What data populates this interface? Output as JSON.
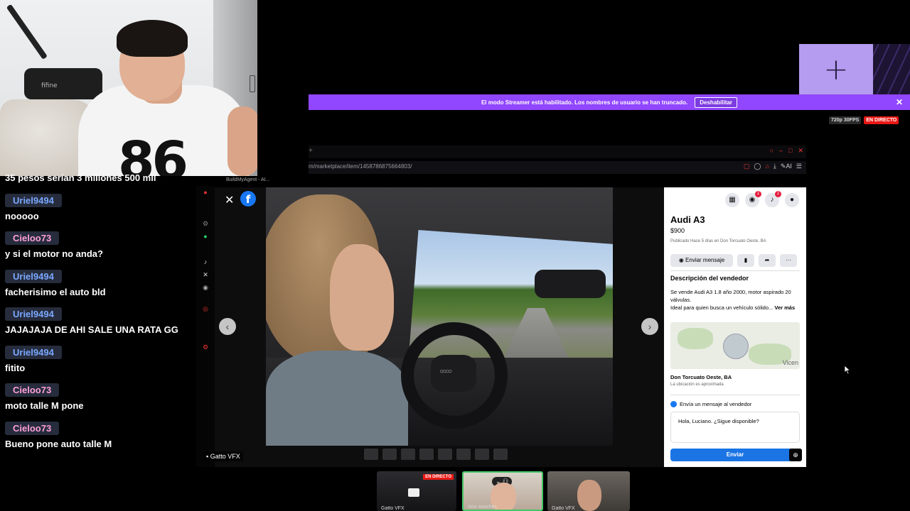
{
  "banner": {
    "text": "El modo Streamer está habilitado. Los nombres de usuario se han truncado.",
    "button": "Deshabilitar",
    "close": "✕"
  },
  "stream": {
    "quality": "720p 30FPS",
    "live": "EN DIRECTO"
  },
  "webcam": {
    "mic_brand": "fifine",
    "jersey_number": "86"
  },
  "add_tile": {
    "icon": "plus-icon"
  },
  "browser": {
    "url": "m/marketplace/item/1458786875664803/",
    "tab_label": "BuildMyAgent - AI..."
  },
  "chat": {
    "first_line": "35 pesos serían 3 millones 500 mil",
    "messages": [
      {
        "user": "Uriel9494",
        "text": "nooooo",
        "color": "blue"
      },
      {
        "user": "Cieloo73",
        "text": "y si el motor no anda?",
        "color": "pink"
      },
      {
        "user": "Uriel9494",
        "text": "facherisimo el auto bld",
        "color": "blue"
      },
      {
        "user": "Uriel9494",
        "text": "JAJAJAJA DE AHI SALE UNA RATA GG",
        "color": "blue"
      },
      {
        "user": "Uriel9494",
        "text": "fitito",
        "color": "blue"
      },
      {
        "user": "Cieloo73",
        "text": "moto talle M pone",
        "color": "pink"
      },
      {
        "user": "Cieloo73",
        "text": "Bueno pone auto talle M",
        "color": "pink"
      }
    ]
  },
  "viewer": {
    "close": "✕",
    "fb": "f",
    "prev": "‹",
    "next": "›",
    "steering_logo": "○○○○",
    "source_label": "Gatto VFX"
  },
  "listing": {
    "title": "Audi A3",
    "price": "$900",
    "published": "Publicado Hace 5 días en Don Torcuato Oeste, BA",
    "message_button": "Enviar mensaje",
    "description_heading": "Descripción del vendedor",
    "description_1": "Se vende Audi A3 1.8 año 2000, motor aspirado 20 válvulas.",
    "description_2": "Ideal para quien busca un vehículo sólido...",
    "see_more": "Ver más",
    "map_label": "Vicen",
    "location": "Don Torcuato Oeste, BA",
    "location_sub": "La ubicación es aproximada",
    "send_heading": "Envía un mensaje al vendedor",
    "message_text": "Hola, Luciano. ¿Sigue disponible?",
    "send_button": "Enviar",
    "notif_badge_1": "1",
    "notif_badge_2": "1"
  },
  "bottom": {
    "t1_label": "Gatto VFX",
    "t1_live": "EN DIRECTO",
    "t2_label": "nico souches",
    "t3_label": "Gatto VFX"
  },
  "colors": {
    "twitch_purple": "#9146ff",
    "live_red": "#e91916",
    "fb_blue": "#1877f2"
  }
}
